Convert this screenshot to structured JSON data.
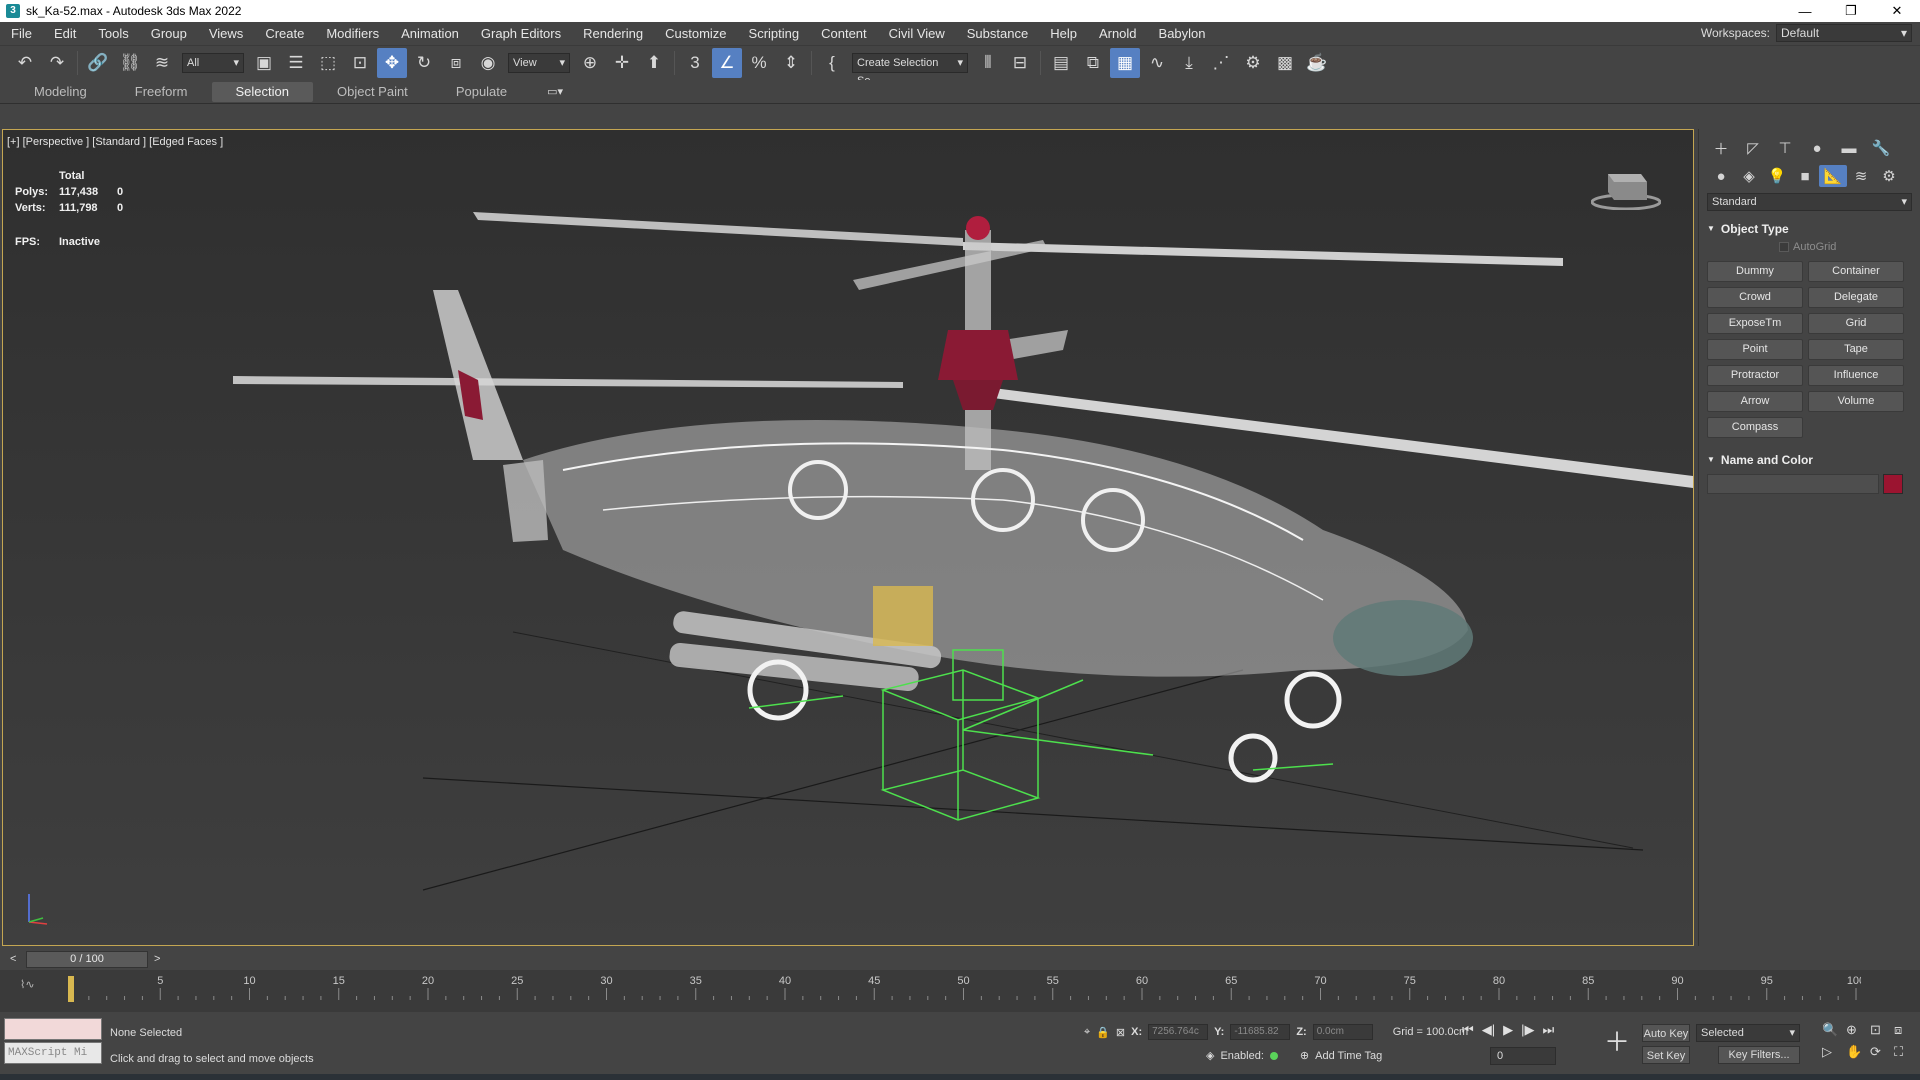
{
  "window": {
    "title": "sk_Ka-52.max - Autodesk 3ds Max 2022"
  },
  "menus": [
    "File",
    "Edit",
    "Tools",
    "Group",
    "Views",
    "Create",
    "Modifiers",
    "Animation",
    "Graph Editors",
    "Rendering",
    "Customize",
    "Scripting",
    "Content",
    "Civil View",
    "Substance",
    "Help",
    "Arnold",
    "Babylon"
  ],
  "workspace": {
    "label": "Workspaces:",
    "value": "Default"
  },
  "toolbar": {
    "filter_value": "All",
    "ref_coord_value": "View",
    "selection_set_placeholder": "Create Selection Se"
  },
  "ribbon_tabs": [
    {
      "label": "Modeling",
      "active": false
    },
    {
      "label": "Freeform",
      "active": false
    },
    {
      "label": "Selection",
      "active": true
    },
    {
      "label": "Object Paint",
      "active": false
    },
    {
      "label": "Populate",
      "active": false
    }
  ],
  "viewport": {
    "label": "[+] [Perspective ] [Standard ] [Edged Faces ]",
    "stats": {
      "header": "Total",
      "polys_label": "Polys:",
      "polys_total": "117,438",
      "polys_sel": "0",
      "verts_label": "Verts:",
      "verts_total": "111,798",
      "verts_sel": "0",
      "fps_label": "FPS:",
      "fps_value": "Inactive"
    }
  },
  "command_panel": {
    "category": "Standard",
    "object_type_title": "Object Type",
    "autogrid_label": "AutoGrid",
    "buttons": [
      "Dummy",
      "Container",
      "Crowd",
      "Delegate",
      "ExposeTm",
      "Grid",
      "Point",
      "Tape",
      "Protractor",
      "Influence",
      "Arrow",
      "Volume",
      "Compass"
    ],
    "name_color_title": "Name and Color",
    "object_color": "#9b1430"
  },
  "time_slider": {
    "position": "0 / 100",
    "prev": "<",
    "next": ">"
  },
  "track_ticks": [
    "0",
    "5",
    "10",
    "15",
    "20",
    "25",
    "30",
    "35",
    "40",
    "45",
    "50",
    "55",
    "60",
    "65",
    "70",
    "75",
    "80",
    "85",
    "90",
    "95",
    "100"
  ],
  "status": {
    "selection": "None Selected",
    "prompt": "Click and drag to select and move objects",
    "maxscript_placeholder": "MAXScript Mi",
    "x_label": "X:",
    "x_value": "7256.764c",
    "y_label": "Y:",
    "y_value": "-11685.82",
    "z_label": "Z:",
    "z_value": "0.0cm",
    "grid": "Grid = 100.0cm",
    "enabled_label": "Enabled:",
    "add_time_tag": "Add Time Tag",
    "auto_key": "Auto Key",
    "set_key": "Set Key",
    "selected_dd": "Selected",
    "key_filters": "Key Filters...",
    "current_frame": "0"
  },
  "colors": {
    "accent": "#5680c2",
    "viewport_border": "#c4a652",
    "helper_green": "#4de04d",
    "rotor_hub": "#8a1a34"
  }
}
